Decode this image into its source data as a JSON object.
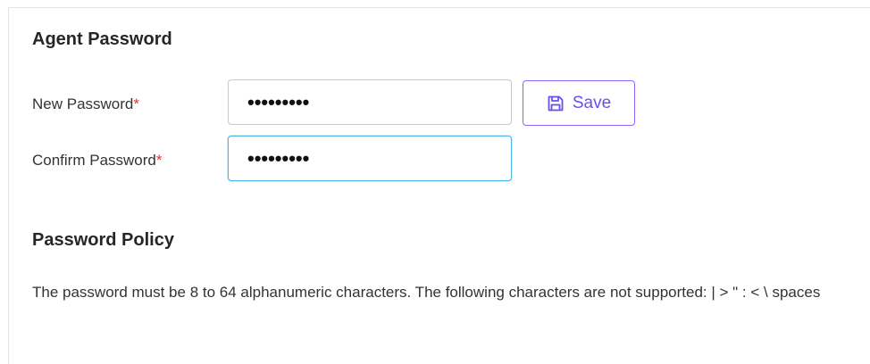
{
  "agent_password": {
    "title": "Agent Password",
    "new_password": {
      "label": "New Password",
      "required_marker": "*",
      "value_mask": "•••••••••"
    },
    "confirm_password": {
      "label": "Confirm Password",
      "required_marker": "*",
      "value_mask": "•••••••••"
    },
    "save_button": {
      "label": "Save",
      "icon": "save-icon"
    }
  },
  "password_policy": {
    "title": "Password Policy",
    "text": "The password must be 8 to 64 alphanumeric characters. The following characters are not supported: | > \" : < \\ spaces"
  },
  "colors": {
    "accent": "#6b4cf5",
    "required": "#d9363e",
    "focus_border": "#4fb3e8"
  }
}
